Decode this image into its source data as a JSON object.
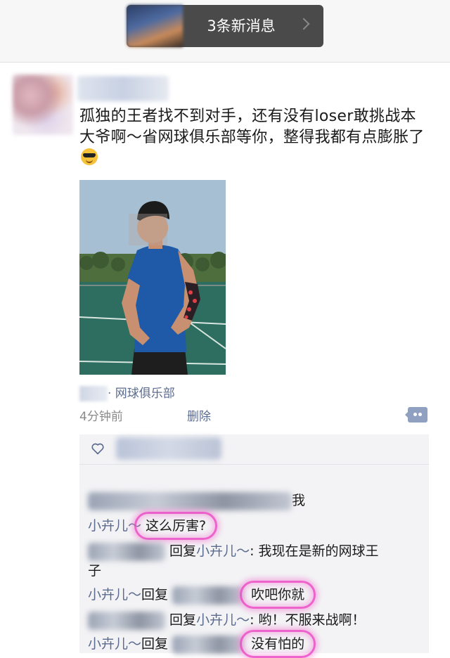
{
  "topbar": {
    "new_messages_label": "3条新消息",
    "chevron_icon": "chevron-right-icon"
  },
  "post": {
    "author_name": "",
    "text": "孤独的王者找不到对手，还有没有loser敢挑战本大爷啊～省网球俱乐部等你，整得我都有点膨胀了",
    "emoji": "sunglasses-emoji",
    "location": "· 网球俱乐部",
    "time": "4分钟前",
    "delete_label": "删除",
    "more_icon": "comment-more-icon"
  },
  "likes": {
    "heart_icon": "heart-outline-icon",
    "names": ""
  },
  "comments": [
    {
      "author": "",
      "reply_to": "",
      "text": "我"
    },
    {
      "author": "小卉儿～",
      "reply_to": "",
      "text": "这么厉害?"
    },
    {
      "author": "",
      "reply_label": "回复",
      "reply_to": "小卉儿～",
      "text": "我现在是新的网球王",
      "text_cont": "子"
    },
    {
      "author": "小卉儿～",
      "reply_label": "回复",
      "reply_to": "",
      "text": "吹吧你就"
    },
    {
      "author": "",
      "reply_label": "回复",
      "reply_to": "小卉儿～",
      "text": "哟！不服来战啊！"
    },
    {
      "author": "小卉儿～",
      "reply_label": "回复",
      "reply_to": "",
      "text": "没有怕的"
    }
  ],
  "colors": {
    "link": "#5b6b8f",
    "highlight": "#ec48c4",
    "comment_bg": "#f3f3f5",
    "pill_bg": "#4a4a4a"
  }
}
